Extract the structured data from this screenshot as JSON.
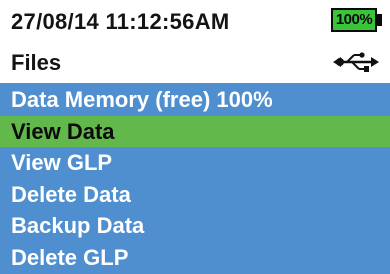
{
  "status": {
    "datetime": "27/08/14  11:12:56AM",
    "battery_percent": "100%",
    "battery_level": 1.0,
    "battery_color": "#39c43a",
    "usb_icon": "usb-icon"
  },
  "header": {
    "title": "Files"
  },
  "menu": {
    "items": [
      {
        "label": "Data Memory (free) 100%"
      },
      {
        "label": "View Data"
      },
      {
        "label": "View GLP"
      },
      {
        "label": "Delete Data"
      },
      {
        "label": "Backup Data"
      },
      {
        "label": "Delete GLP"
      }
    ],
    "selected_index": 1,
    "list_color": "#4f8fd0",
    "selected_color": "#63b84b"
  }
}
